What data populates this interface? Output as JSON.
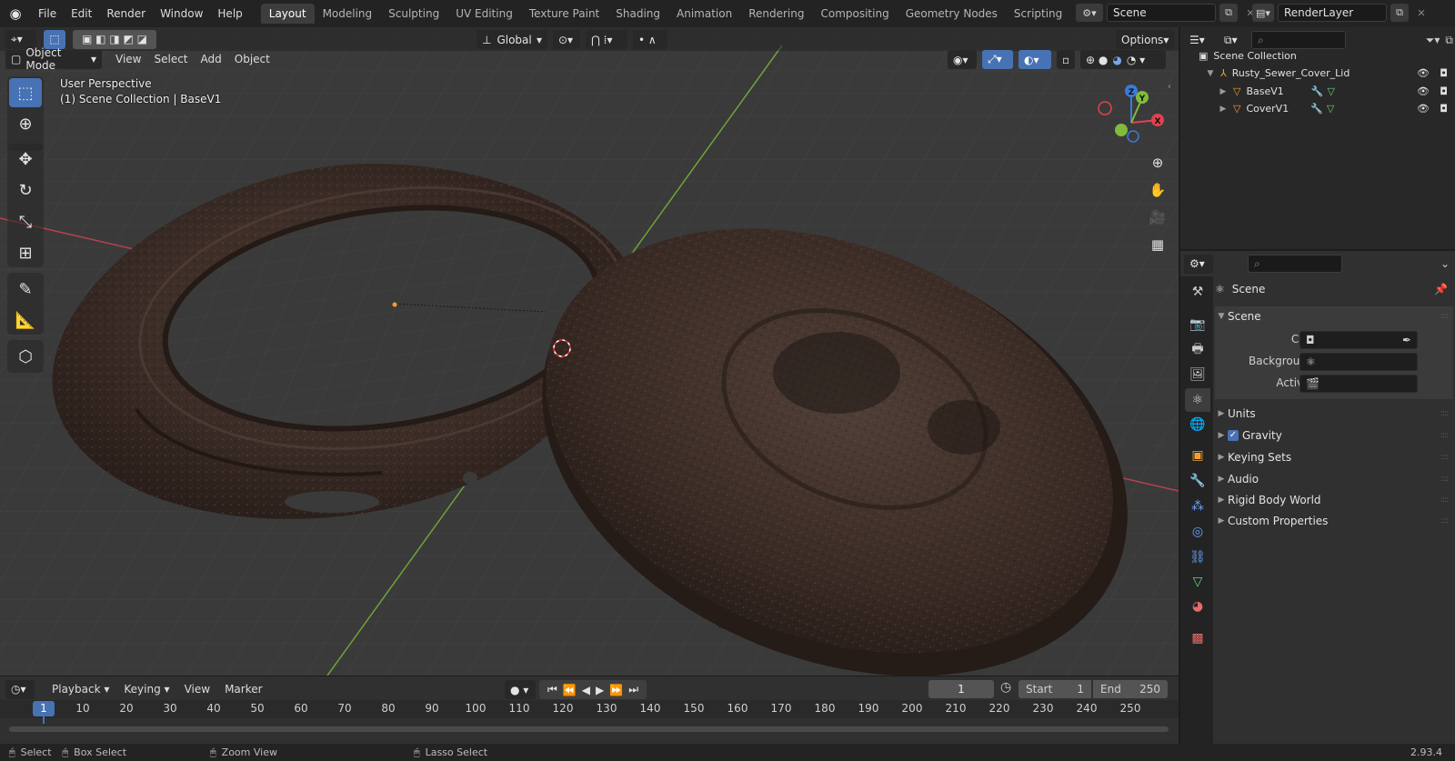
{
  "menus": [
    "File",
    "Edit",
    "Render",
    "Window",
    "Help"
  ],
  "workspace_tabs": [
    "Layout",
    "Modeling",
    "Sculpting",
    "UV Editing",
    "Texture Paint",
    "Shading",
    "Animation",
    "Rendering",
    "Compositing",
    "Geometry Nodes",
    "Scripting"
  ],
  "active_workspace": "Layout",
  "scene_name": "Scene",
  "view_layer": "RenderLayer",
  "viewport": {
    "transform_orientation": "Global",
    "options_label": "Options",
    "mode": "Object Mode",
    "header_menus": [
      "View",
      "Select",
      "Add",
      "Object"
    ],
    "overlay_line1": "User Perspective",
    "overlay_line2": "(1) Scene Collection | BaseV1",
    "gizmo_axes": {
      "x": "X",
      "y": "Y",
      "z": "Z"
    }
  },
  "outliner": {
    "root": "Scene Collection",
    "items": [
      {
        "name": "Rusty_Sewer_Cover_Lid",
        "level": 1
      },
      {
        "name": "BaseV1",
        "level": 2
      },
      {
        "name": "CoverV1",
        "level": 2
      }
    ]
  },
  "properties": {
    "context_title": "Scene",
    "panel_title": "Scene",
    "fields": [
      {
        "label": "Camera",
        "value": ""
      },
      {
        "label": "Background Sce...",
        "value": ""
      },
      {
        "label": "Active Clip",
        "value": ""
      }
    ],
    "panels": [
      "Units",
      "Gravity",
      "Keying Sets",
      "Audio",
      "Rigid Body World",
      "Custom Properties"
    ],
    "gravity_checked": true
  },
  "timeline": {
    "menus": [
      "Playback",
      "Keying",
      "View",
      "Marker"
    ],
    "current_frame": "1",
    "start_label": "Start",
    "start": "1",
    "end_label": "End",
    "end": "250",
    "frame_marks": [
      "10",
      "20",
      "30",
      "40",
      "50",
      "60",
      "70",
      "80",
      "90",
      "100",
      "110",
      "120",
      "130",
      "140",
      "150",
      "160",
      "170",
      "180",
      "190",
      "200",
      "210",
      "220",
      "230",
      "240",
      "250"
    ],
    "current_marker": "1"
  },
  "statusbar": {
    "hints": [
      "Select",
      "Box Select",
      "Zoom View",
      "Lasso Select"
    ],
    "version": "2.93.4"
  },
  "colors": {
    "accent": "#4772b3",
    "x_axis": "#e3414f",
    "y_axis": "#7fbc3c",
    "z_axis": "#3b7ad6"
  }
}
